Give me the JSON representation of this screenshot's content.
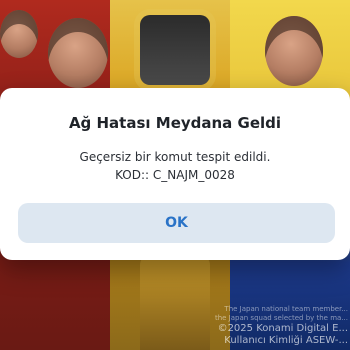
{
  "dialog": {
    "title": "Ağ Hatası Meydana Geldi",
    "message_line1": "Geçersiz bir komut tespit edildi.",
    "message_line2": "KOD:: C_NAJM_0028",
    "ok_label": "OK"
  },
  "background": {
    "caption_line1": "The Japan national team member...",
    "caption_line2": "the Japan squad selected by the ma...",
    "copyright_line1": "©2025 Konami Digital E...",
    "copyright_line2": "Kullanıcı Kimliği ASEW-..."
  },
  "colors": {
    "button_bg": "#dde7f1",
    "button_text": "#2a73c7"
  }
}
